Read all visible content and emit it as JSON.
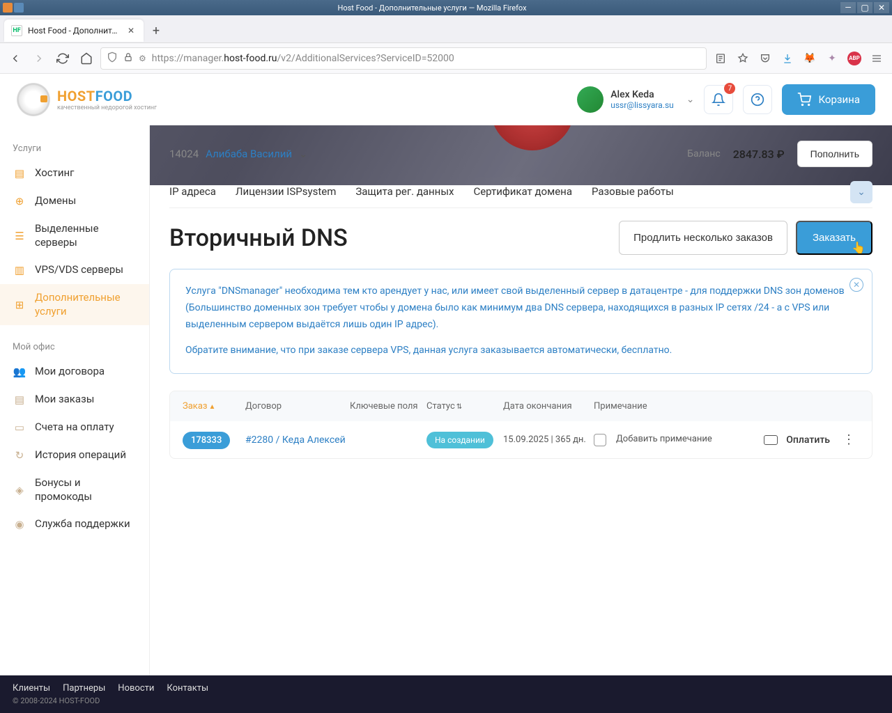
{
  "os": {
    "title": "Host Food - Дополнительные услуги — Mozilla Firefox"
  },
  "browser": {
    "tab_title": "Host Food - Дополнительны",
    "url_prefix": "https://manager.",
    "url_domain": "host-food.ru",
    "url_path": "/v2/AdditionalServices?ServiceID=52000"
  },
  "logo": {
    "part1": "HOST",
    "part2": "FOOD",
    "sub": "качественный недорогой хостинг"
  },
  "user": {
    "name": "Alex Keda",
    "email": "ussr@lissyara.su"
  },
  "notif_count": "7",
  "cart_label": "Корзина",
  "account": {
    "id": "14024",
    "name": "Алибаба Василий"
  },
  "balance": {
    "label": "Баланс",
    "value": "2847.83 ₽",
    "topup": "Пополнить"
  },
  "sidebar": {
    "section1": "Услуги",
    "items1": [
      "Хостинг",
      "Домены",
      "Выделенные серверы",
      "VPS/VDS серверы",
      "Дополнительные услуги"
    ],
    "section2": "Мой офис",
    "items2": [
      "Мои договора",
      "Мои заказы",
      "Счета на оплату",
      "История операций",
      "Бонусы и промокоды",
      "Служба поддержки"
    ]
  },
  "tabs": [
    "IP адреса",
    "Лицензии ISPsystem",
    "Защита рег. данных",
    "Сертификат домена",
    "Разовые работы"
  ],
  "page_title": "Вторичный DNS",
  "actions": {
    "extend": "Продлить несколько заказов",
    "order": "Заказать"
  },
  "info": {
    "p1": "Услуга \"DNSmanager\" необходима тем кто арендует у нас, или имеет свой выделенный сервер в датацентре - для поддержки DNS зон доменов (Большинство доменных зон требует чтобы у домена было как минимум два DNS сервера, находящихся в разных IP сетях /24 - а с VPS или выделенным сервером выдаётся лишь один IP адрес).",
    "p2": "Обратите внимание, что при заказе сервера VPS, данная услуга заказывается автоматически, бесплатно."
  },
  "table": {
    "headers": {
      "order": "Заказ",
      "contract": "Договор",
      "keys": "Ключевые поля",
      "status": "Статус",
      "date": "Дата окончания",
      "note": "Примечание"
    },
    "row": {
      "order": "178333",
      "contract": "#2280 / Кеда Алексей",
      "status": "На создании",
      "date": "15.09.2025 | 365 дн.",
      "note": "Добавить примечание",
      "pay": "Оплатить"
    }
  },
  "footer": {
    "links": [
      "Клиенты",
      "Партнеры",
      "Новости",
      "Контакты"
    ],
    "copy": "© 2008-2024 HOST-FOOD"
  }
}
